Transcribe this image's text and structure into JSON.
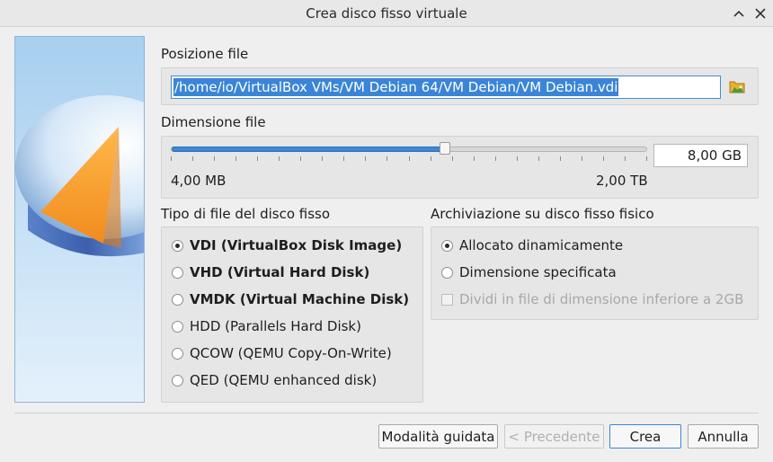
{
  "window": {
    "title": "Crea disco fisso virtuale"
  },
  "file_location": {
    "label": "Posizione file",
    "path": "/home/io/VirtualBox VMs/VM Debian 64/VM Debian/VM Debian.vdi"
  },
  "file_size": {
    "label": "Dimensione file",
    "value": "8,00 GB",
    "min_label": "4,00 MB",
    "max_label": "2,00 TB",
    "slider_fraction": 0.575
  },
  "disk_type": {
    "label": "Tipo di file del disco fisso",
    "options": [
      {
        "label": "VDI (VirtualBox Disk Image)",
        "checked": true,
        "bold": true
      },
      {
        "label": "VHD (Virtual Hard Disk)",
        "checked": false,
        "bold": true
      },
      {
        "label": "VMDK (Virtual Machine Disk)",
        "checked": false,
        "bold": true
      },
      {
        "label": "HDD (Parallels Hard Disk)",
        "checked": false,
        "bold": false
      },
      {
        "label": "QCOW (QEMU Copy-On-Write)",
        "checked": false,
        "bold": false
      },
      {
        "label": "QED (QEMU enhanced disk)",
        "checked": false,
        "bold": false
      }
    ]
  },
  "storage": {
    "label": "Archiviazione su disco fisso fisico",
    "dynamic": "Allocato dinamicamente",
    "fixed": "Dimensione specificata",
    "split": "Dividi in file di dimensione inferiore a 2GB"
  },
  "buttons": {
    "guided": "Modalità guidata",
    "back": "< Precedente",
    "create": "Crea",
    "cancel": "Annulla"
  },
  "colors": {
    "accent": "#3b85d6",
    "background": "#efefef"
  }
}
